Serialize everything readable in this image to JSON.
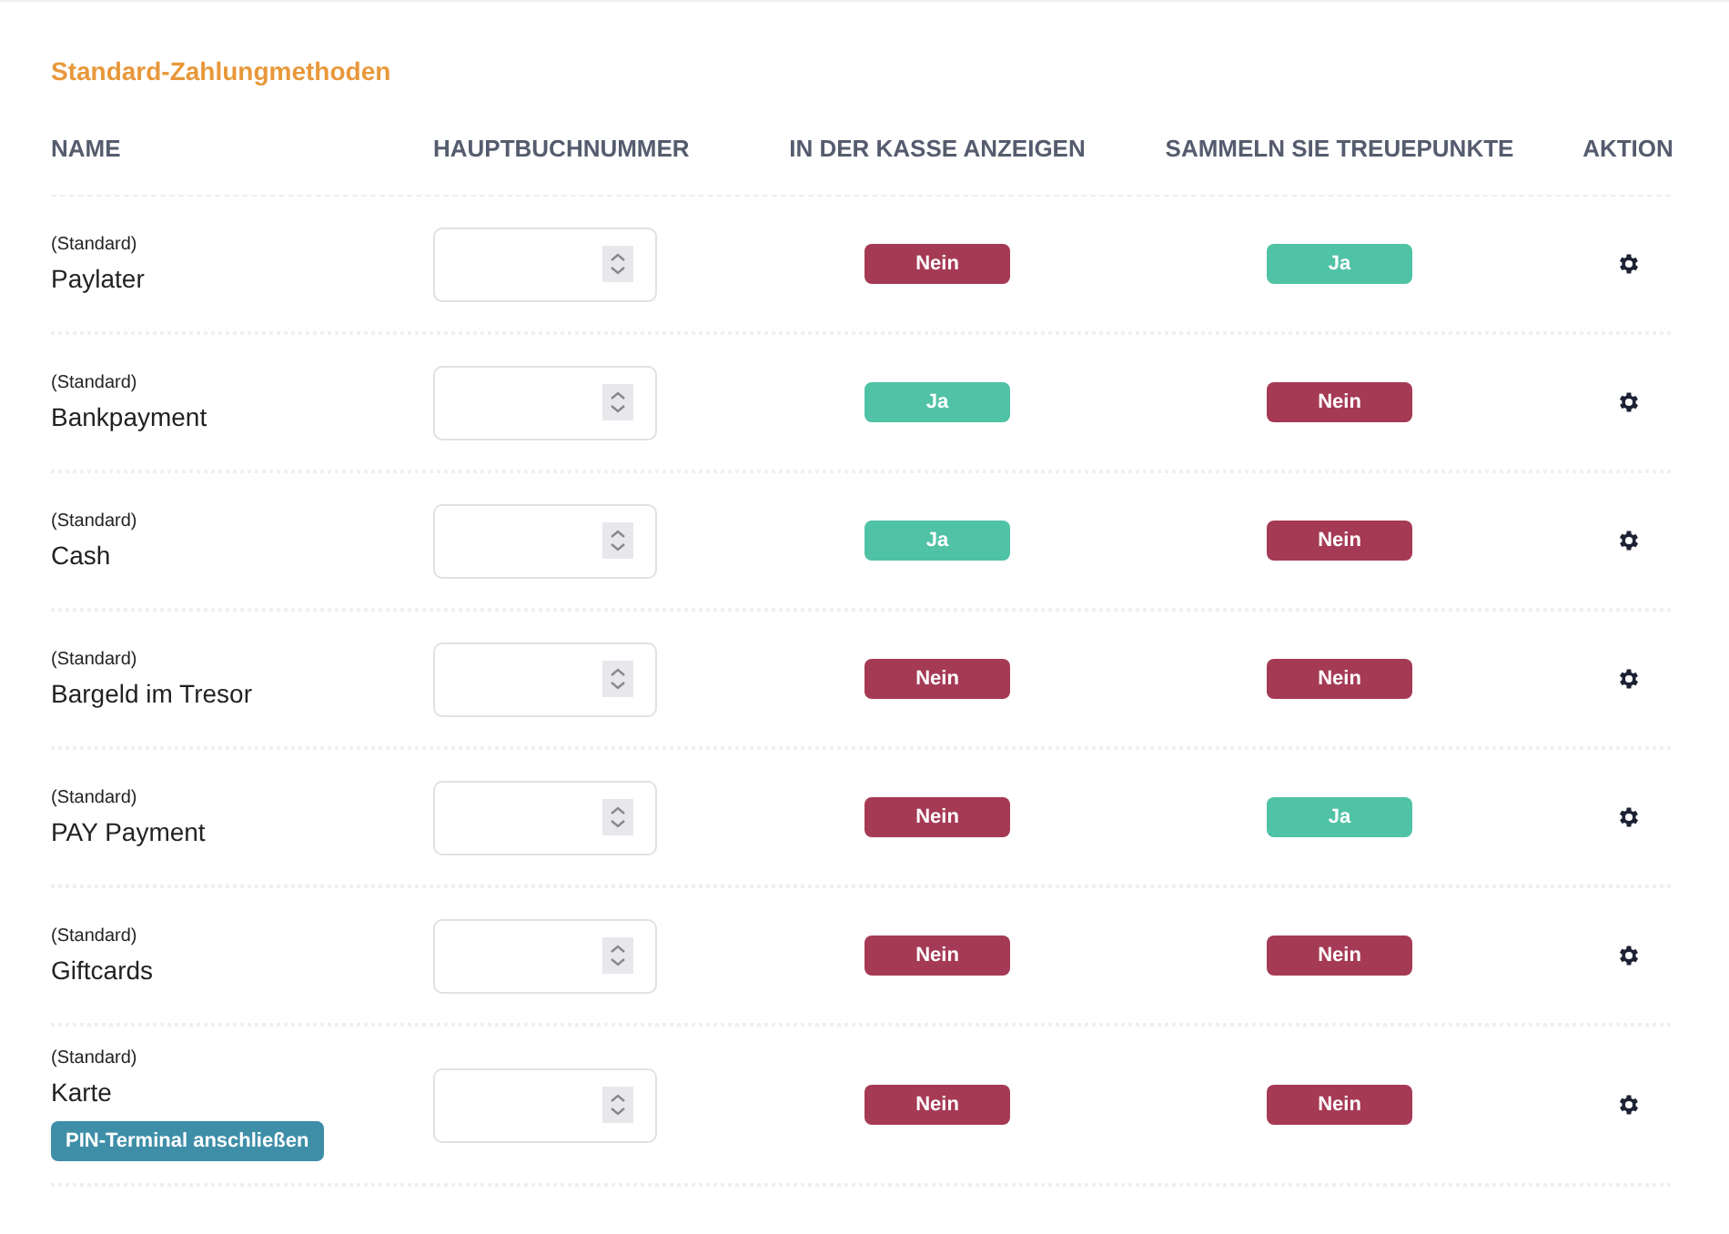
{
  "section_title": "Standard-Zahlungmethoden",
  "table": {
    "columns": [
      "NAME",
      "HAUPTBUCHNUMMER",
      "IN DER KASSE ANZEIGEN",
      "SAMMELN SIE TREUEPUNKTE",
      "AKTION"
    ],
    "rows": [
      {
        "tag": "(Standard)",
        "name": "Paylater",
        "show_in_pos": {
          "label": "Nein",
          "on": false
        },
        "loyalty_points": {
          "label": "Ja",
          "on": true
        }
      },
      {
        "tag": "(Standard)",
        "name": "Bankpayment",
        "show_in_pos": {
          "label": "Ja",
          "on": true
        },
        "loyalty_points": {
          "label": "Nein",
          "on": false
        }
      },
      {
        "tag": "(Standard)",
        "name": "Cash",
        "show_in_pos": {
          "label": "Ja",
          "on": true
        },
        "loyalty_points": {
          "label": "Nein",
          "on": false
        }
      },
      {
        "tag": "(Standard)",
        "name": "Bargeld im Tresor",
        "show_in_pos": {
          "label": "Nein",
          "on": false
        },
        "loyalty_points": {
          "label": "Nein",
          "on": false
        }
      },
      {
        "tag": "(Standard)",
        "name": "PAY Payment",
        "show_in_pos": {
          "label": "Nein",
          "on": false
        },
        "loyalty_points": {
          "label": "Ja",
          "on": true
        }
      },
      {
        "tag": "(Standard)",
        "name": "Giftcards",
        "show_in_pos": {
          "label": "Nein",
          "on": false
        },
        "loyalty_points": {
          "label": "Nein",
          "on": false
        }
      },
      {
        "tag": "(Standard)",
        "name": "Karte",
        "action_button": "PIN-Terminal anschließen",
        "show_in_pos": {
          "label": "Nein",
          "on": false
        },
        "loyalty_points": {
          "label": "Nein",
          "on": false
        }
      }
    ]
  }
}
